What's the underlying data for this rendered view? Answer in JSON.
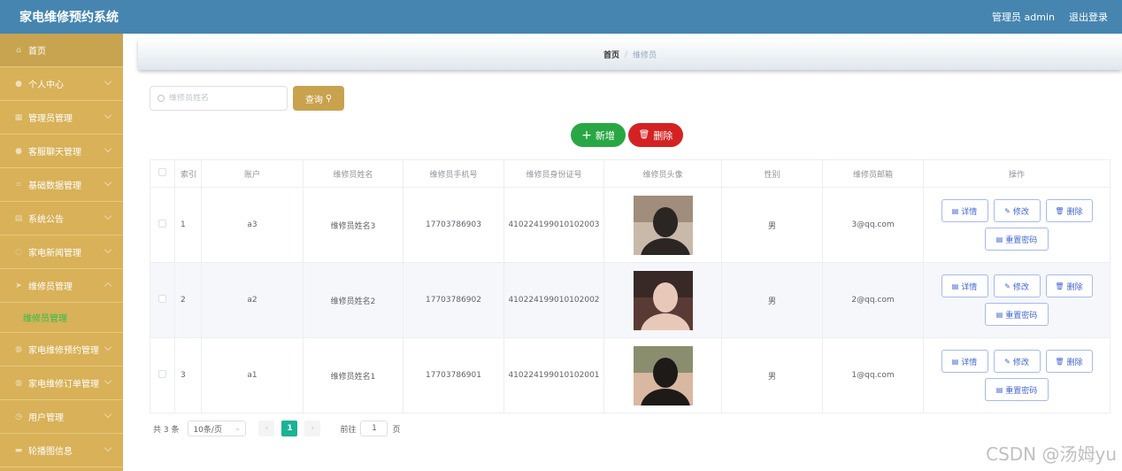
{
  "app": {
    "title": "家电维修预约系统"
  },
  "header": {
    "user_label": "管理员 admin",
    "logout_label": "退出登录"
  },
  "sidebar": {
    "items": [
      {
        "label": "首页",
        "icon": "home-icon"
      },
      {
        "label": "个人中心",
        "icon": "user-icon"
      },
      {
        "label": "管理员管理",
        "icon": "grid-icon"
      },
      {
        "label": "客服聊天管理",
        "icon": "user-icon"
      },
      {
        "label": "基础数据管理",
        "icon": "crop-icon"
      },
      {
        "label": "系统公告",
        "icon": "doc-icon"
      },
      {
        "label": "家电新闻管理",
        "icon": "circle-icon"
      },
      {
        "label": "维修员管理",
        "icon": "plane-icon"
      },
      {
        "label": "家电维修预约管理",
        "icon": "globe-icon"
      },
      {
        "label": "家电维修订单管理",
        "icon": "globe-icon"
      },
      {
        "label": "用户管理",
        "icon": "clock-icon"
      },
      {
        "label": "轮播图信息",
        "icon": "box-icon"
      }
    ],
    "active_sub": "维修员管理"
  },
  "breadcrumb": {
    "home": "首页",
    "separator": "/",
    "current": "维修员"
  },
  "search": {
    "placeholder": "维修员姓名",
    "value": "",
    "button_label": "查询"
  },
  "actions": {
    "add_label": "新增",
    "delete_label": "删除"
  },
  "table": {
    "headers": [
      "",
      "索引",
      "账户",
      "维修员姓名",
      "维修员手机号",
      "维修员身份证号",
      "维修员头像",
      "性别",
      "维修员邮箱",
      "操作"
    ],
    "rows": [
      {
        "index": "1",
        "account": "a3",
        "name": "维修员姓名3",
        "phone": "17703786903",
        "id_card": "410224199010102003",
        "gender": "男",
        "email": "3@qq.com",
        "avatar_colors": [
          "#8f7a68",
          "#2b2623",
          "#c9b9a8"
        ]
      },
      {
        "index": "2",
        "account": "a2",
        "name": "维修员姓名2",
        "phone": "17703786902",
        "id_card": "410224199010102002",
        "gender": "男",
        "email": "2@qq.com",
        "avatar_colors": [
          "#2a2222",
          "#e8c9b9",
          "#5a3a35"
        ]
      },
      {
        "index": "3",
        "account": "a1",
        "name": "维修员姓名1",
        "phone": "17703786901",
        "id_card": "410224199010102001",
        "gender": "男",
        "email": "1@qq.com",
        "avatar_colors": [
          "#6b7a5a",
          "#1e1a18",
          "#d8b8a0"
        ]
      }
    ],
    "ops": {
      "detail": "详情",
      "edit": "修改",
      "delete": "删除",
      "reset_pwd": "重置密码"
    }
  },
  "pagination": {
    "total_label": "共 3 条",
    "page_size": "10条/页",
    "current_page": "1",
    "goto_label": "前往",
    "goto_value": "1",
    "page_unit": "页"
  },
  "watermark": "CSDN @汤姆yu"
}
